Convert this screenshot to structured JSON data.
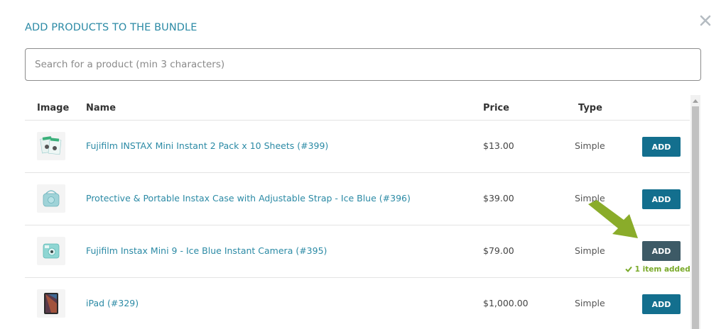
{
  "modal": {
    "title": "ADD PRODUCTS TO THE BUNDLE",
    "close_icon": "close-icon"
  },
  "search": {
    "placeholder": "Search for a product (min 3 characters)",
    "value": ""
  },
  "table": {
    "columns": [
      "Image",
      "Name",
      "Price",
      "Type"
    ],
    "rows": [
      {
        "name": "Fujifilm INSTAX Mini Instant 2 Pack x 10 Sheets (#399)",
        "price": "$13.00",
        "type": "Simple",
        "button": "ADD",
        "image_icon": "film-pack-icon"
      },
      {
        "name": "Protective & Portable Instax Case with Adjustable Strap - Ice Blue (#396)",
        "price": "$39.00",
        "type": "Simple",
        "button": "ADD",
        "image_icon": "camera-case-icon"
      },
      {
        "name": "Fujifilm Instax Mini 9 - Ice Blue Instant Camera (#395)",
        "price": "$79.00",
        "type": "Simple",
        "button": "ADD",
        "status": "1 item added",
        "image_icon": "instant-camera-icon"
      },
      {
        "name": "iPad (#329)",
        "price": "$1,000.00",
        "type": "Simple",
        "button": "ADD",
        "image_icon": "tablet-icon"
      }
    ]
  },
  "colors": {
    "accent": "#2b8aa5",
    "button": "#136f8e",
    "button_active": "#3d5a66",
    "success": "#7aaa2a",
    "arrow": "#8aac2a"
  }
}
